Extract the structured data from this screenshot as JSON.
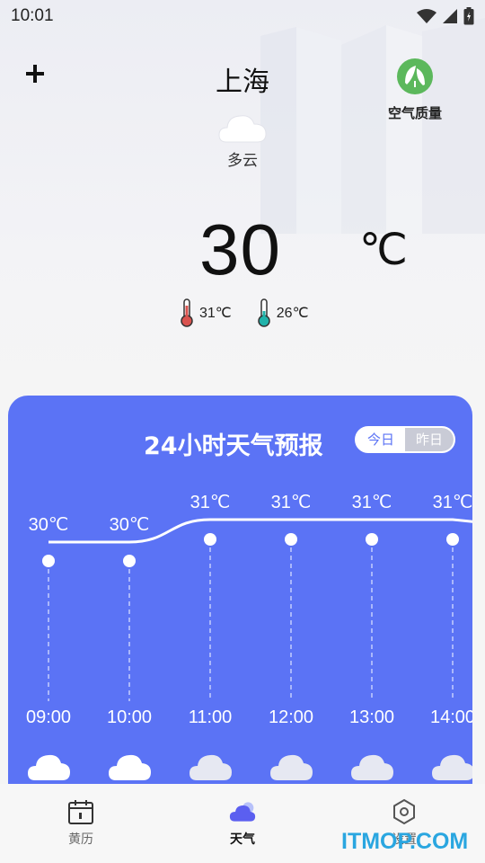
{
  "status": {
    "time": "10:01"
  },
  "header": {
    "city": "上海",
    "aqi_label": "空气质量"
  },
  "weather": {
    "condition": "多云",
    "temperature": "30",
    "unit": "℃",
    "high": "31℃",
    "low": "26℃"
  },
  "forecast": {
    "title": "24小时天气预报",
    "toggle_today": "今日",
    "toggle_yesterday": "昨日",
    "hours": [
      {
        "time": "09:00",
        "temp": "30℃",
        "value": 30,
        "icon": "cloud-icon"
      },
      {
        "time": "10:00",
        "temp": "30℃",
        "value": 30,
        "icon": "cloud-icon"
      },
      {
        "time": "11:00",
        "temp": "31℃",
        "value": 31,
        "icon": "cloud-icon"
      },
      {
        "time": "12:00",
        "temp": "31℃",
        "value": 31,
        "icon": "cloud-icon"
      },
      {
        "time": "13:00",
        "temp": "31℃",
        "value": 31,
        "icon": "cloud-icon"
      },
      {
        "time": "14:00",
        "temp": "31℃",
        "value": 31,
        "icon": "cloud-icon"
      }
    ]
  },
  "nav": {
    "items": [
      {
        "label": "黄历",
        "icon": "calendar-icon",
        "active": false
      },
      {
        "label": "天气",
        "icon": "cloud-icon",
        "active": true
      },
      {
        "label": "设置",
        "icon": "settings-icon",
        "active": false
      }
    ]
  },
  "watermark": "ITMOP.COM",
  "colors": {
    "accent": "#5b73f5",
    "card": "#5b73f5",
    "leaf": "#5cb85c"
  }
}
